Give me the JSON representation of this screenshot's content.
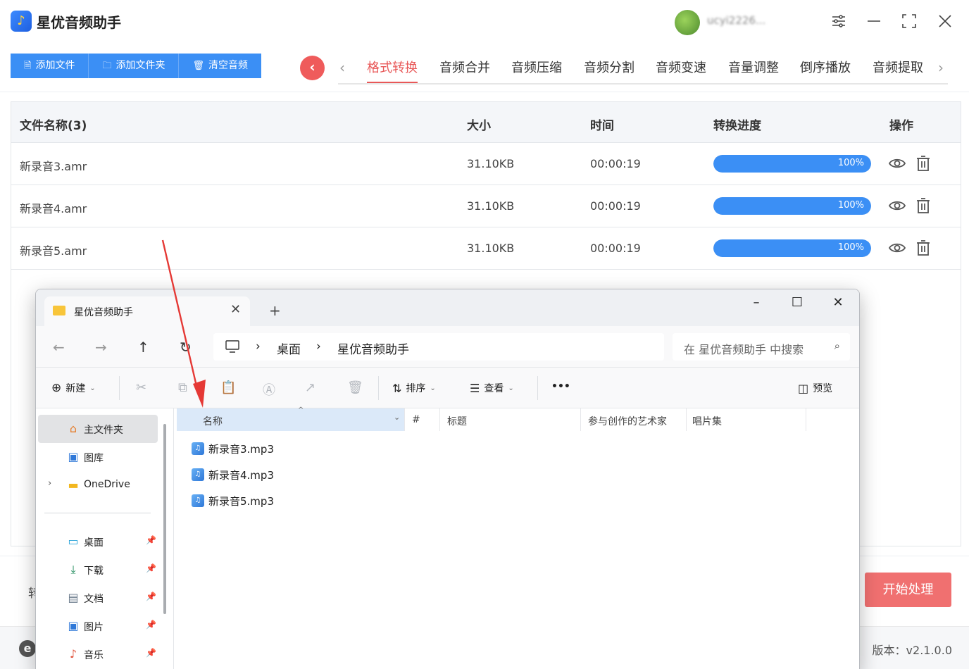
{
  "app": {
    "title": "星优音频助手",
    "user_name": "ucyi2226..."
  },
  "toolbar": {
    "add_file": "添加文件",
    "add_folder": "添加文件夹",
    "clear_audio": "清空音频"
  },
  "tabs": [
    "格式转换",
    "音频合并",
    "音频压缩",
    "音频分割",
    "音频变速",
    "音量调整",
    "倒序播放",
    "音频提取"
  ],
  "active_tab_index": 0,
  "table": {
    "headers": {
      "name": "文件名称(3)",
      "size": "大小",
      "time": "时间",
      "progress": "转换进度",
      "ops": "操作"
    },
    "rows": [
      {
        "name": "新录音3.amr",
        "size": "31.10KB",
        "time": "00:00:19",
        "progress_pct": 100,
        "progress_label": "100%"
      },
      {
        "name": "新录音4.amr",
        "size": "31.10KB",
        "time": "00:00:19",
        "progress_pct": 100,
        "progress_label": "100%"
      },
      {
        "name": "新录音5.amr",
        "size": "31.10KB",
        "time": "00:00:19",
        "progress_pct": 100,
        "progress_label": "100%"
      }
    ]
  },
  "start_button": "开始处理",
  "version": "版本：v2.1.0.0",
  "left_peek_text": "转",
  "explorer": {
    "tab_title": "星优音频助手",
    "path": [
      "桌面",
      "星优音频助手"
    ],
    "search_placeholder": "在 星优音频助手 中搜索",
    "commands": {
      "new": "新建",
      "sort": "排序",
      "view": "查看",
      "more": "•••",
      "preview": "预览"
    },
    "nav_items": [
      {
        "label": "主文件夹",
        "icon": "home-icon",
        "pinned": false,
        "selected": true
      },
      {
        "label": "图库",
        "icon": "gallery-icon",
        "pinned": false,
        "selected": false
      },
      {
        "label": "OneDrive",
        "icon": "folder-icon",
        "pinned": false,
        "selected": false,
        "expandable": true
      },
      {
        "label": "桌面",
        "icon": "desktop-icon",
        "pinned": true,
        "selected": false
      },
      {
        "label": "下载",
        "icon": "download-icon",
        "pinned": true,
        "selected": false
      },
      {
        "label": "文档",
        "icon": "document-icon",
        "pinned": true,
        "selected": false
      },
      {
        "label": "图片",
        "icon": "picture-icon",
        "pinned": true,
        "selected": false
      },
      {
        "label": "音乐",
        "icon": "music-icon",
        "pinned": true,
        "selected": false
      }
    ],
    "columns": [
      "名称",
      "#",
      "标题",
      "参与创作的艺术家",
      "唱片集"
    ],
    "files": [
      "新录音3.mp3",
      "新录音4.mp3",
      "新录音5.mp3"
    ]
  },
  "colors": {
    "accent_blue": "#3b8ff5",
    "accent_red": "#e85858",
    "annotation_arrow": "#e53935"
  }
}
